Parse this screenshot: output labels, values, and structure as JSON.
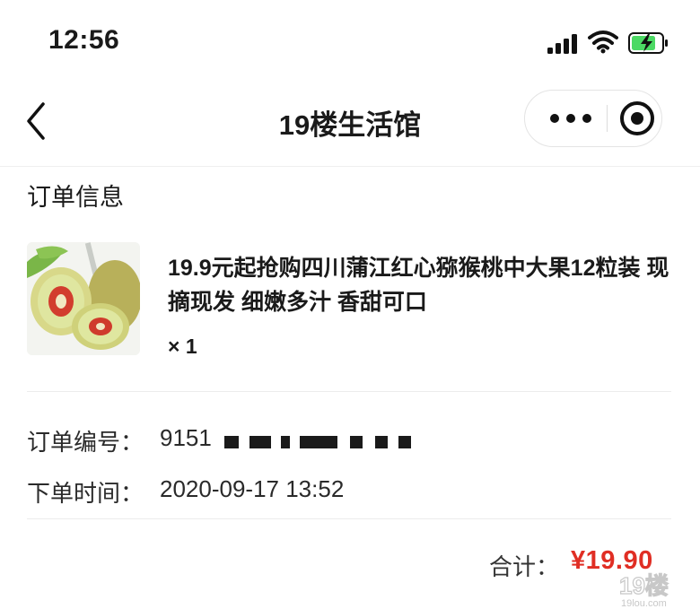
{
  "status_bar": {
    "time": "12:56"
  },
  "nav": {
    "title": "19楼生活馆"
  },
  "section": {
    "title": "订单信息"
  },
  "product": {
    "title": "19.9元起抢购四川蒲江红心猕猴桃中大果12粒装 现摘现发 细嫩多汁 香甜可口",
    "quantity": "× 1"
  },
  "order": {
    "number_label": "订单编号：",
    "number_value": "9151",
    "time_label": "下单时间：",
    "time_value": "2020-09-17 13:52"
  },
  "summary": {
    "total_label": "合计：",
    "total_amount": "¥19.90"
  },
  "watermark": {
    "text": "19楼",
    "subtext": "19lou.com"
  },
  "colors": {
    "price": "#e02e24",
    "text": "#1a1a1a",
    "divider": "#ececec"
  }
}
